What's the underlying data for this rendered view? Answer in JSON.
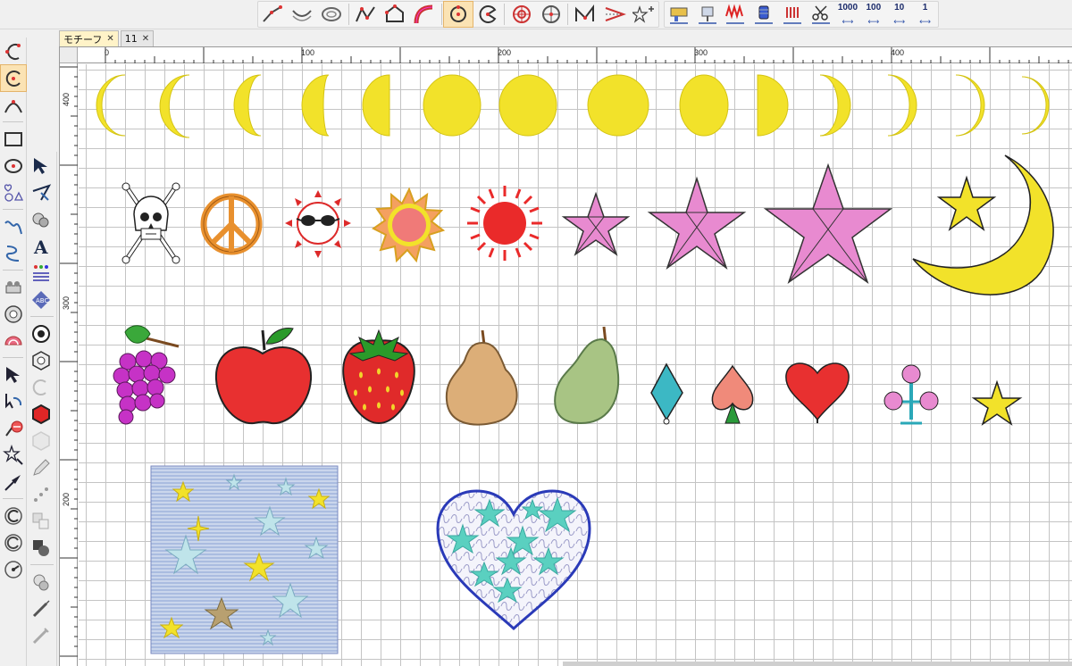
{
  "tabs": [
    {
      "label": "モチーフ",
      "close": "✕",
      "active": true
    },
    {
      "label": "11",
      "close": "✕",
      "active": false
    }
  ],
  "toolbar": {
    "stitch_steps": [
      {
        "value": "1000",
        "arrow": "⟷"
      },
      {
        "value": "100",
        "arrow": "⟷"
      },
      {
        "value": "10",
        "arrow": "⟷"
      },
      {
        "value": "1",
        "arrow": "⟷"
      }
    ]
  },
  "ruler": {
    "top": [
      {
        "label": "0"
      },
      {
        "label": "100"
      },
      {
        "label": "200"
      },
      {
        "label": "300"
      },
      {
        "label": "400"
      }
    ],
    "left": [
      {
        "label": "400"
      },
      {
        "label": "300"
      },
      {
        "label": "200"
      }
    ]
  },
  "motif_groups": {
    "row1": "moon phases",
    "row2": "symbols and stars",
    "row3": "fruits and card suits",
    "row4": "star patterns"
  },
  "colors": {
    "moon_yellow": "#f2e22a",
    "star_pink": "#e88ad0",
    "red": "#e02626",
    "grid": "#c4c4c4",
    "active_tab": "#fff3c8"
  }
}
